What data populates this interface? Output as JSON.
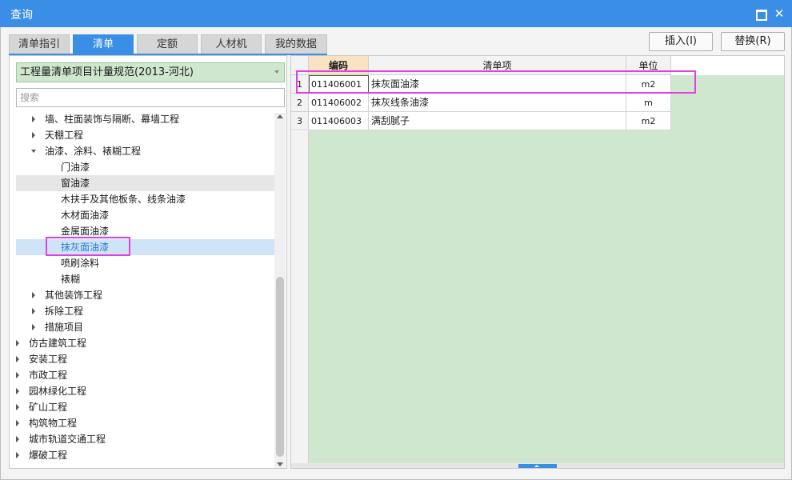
{
  "window": {
    "title": "查询"
  },
  "tabs": [
    "清单指引",
    "清单",
    "定额",
    "人材机",
    "我的数据"
  ],
  "buttons": {
    "insert": "插入(I)",
    "replace": "替换(R)"
  },
  "spec_select": {
    "value": "工程量清单项目计量规范(2013-河北)"
  },
  "search": {
    "placeholder": "搜索"
  },
  "tree": [
    {
      "label": "墙、柱面装饰与隔断、幕墙工程",
      "state": "collapsed"
    },
    {
      "label": "天棚工程",
      "state": "collapsed"
    },
    {
      "label": "油漆、涂料、裱糊工程",
      "state": "expanded"
    },
    {
      "label": "门油漆",
      "state": "leaf"
    },
    {
      "label": "窗油漆",
      "state": "leaf"
    },
    {
      "label": "木扶手及其他板条、线条油漆",
      "state": "leaf"
    },
    {
      "label": "木材面油漆",
      "state": "leaf"
    },
    {
      "label": "金属面油漆",
      "state": "leaf"
    },
    {
      "label": "抹灰面油漆",
      "state": "leaf"
    },
    {
      "label": "喷刷涂料",
      "state": "leaf"
    },
    {
      "label": "裱糊",
      "state": "leaf"
    },
    {
      "label": "其他装饰工程",
      "state": "collapsed"
    },
    {
      "label": "拆除工程",
      "state": "collapsed"
    },
    {
      "label": "措施项目",
      "state": "collapsed"
    },
    {
      "label": "仿古建筑工程",
      "state": "collapsed"
    },
    {
      "label": "安装工程",
      "state": "collapsed"
    },
    {
      "label": "市政工程",
      "state": "collapsed"
    },
    {
      "label": "园林绿化工程",
      "state": "collapsed"
    },
    {
      "label": "矿山工程",
      "state": "collapsed"
    },
    {
      "label": "构筑物工程",
      "state": "collapsed"
    },
    {
      "label": "城市轨道交通工程",
      "state": "collapsed"
    },
    {
      "label": "爆破工程",
      "state": "collapsed"
    }
  ],
  "table": {
    "columns": [
      "编码",
      "清单项",
      "单位"
    ],
    "rows": [
      {
        "num": "1",
        "code": "011406001",
        "name": "抹灰面油漆",
        "unit": "m2"
      },
      {
        "num": "2",
        "code": "011406002",
        "name": "抹灰线条油漆",
        "unit": "m"
      },
      {
        "num": "3",
        "code": "011406003",
        "name": "满刮腻子",
        "unit": "m2"
      }
    ]
  },
  "colors": {
    "accent": "#3a8ee6",
    "highlight_box": "#e040e0",
    "grid_bg": "#cfe6cf",
    "code_header": "#f9e3c2"
  }
}
